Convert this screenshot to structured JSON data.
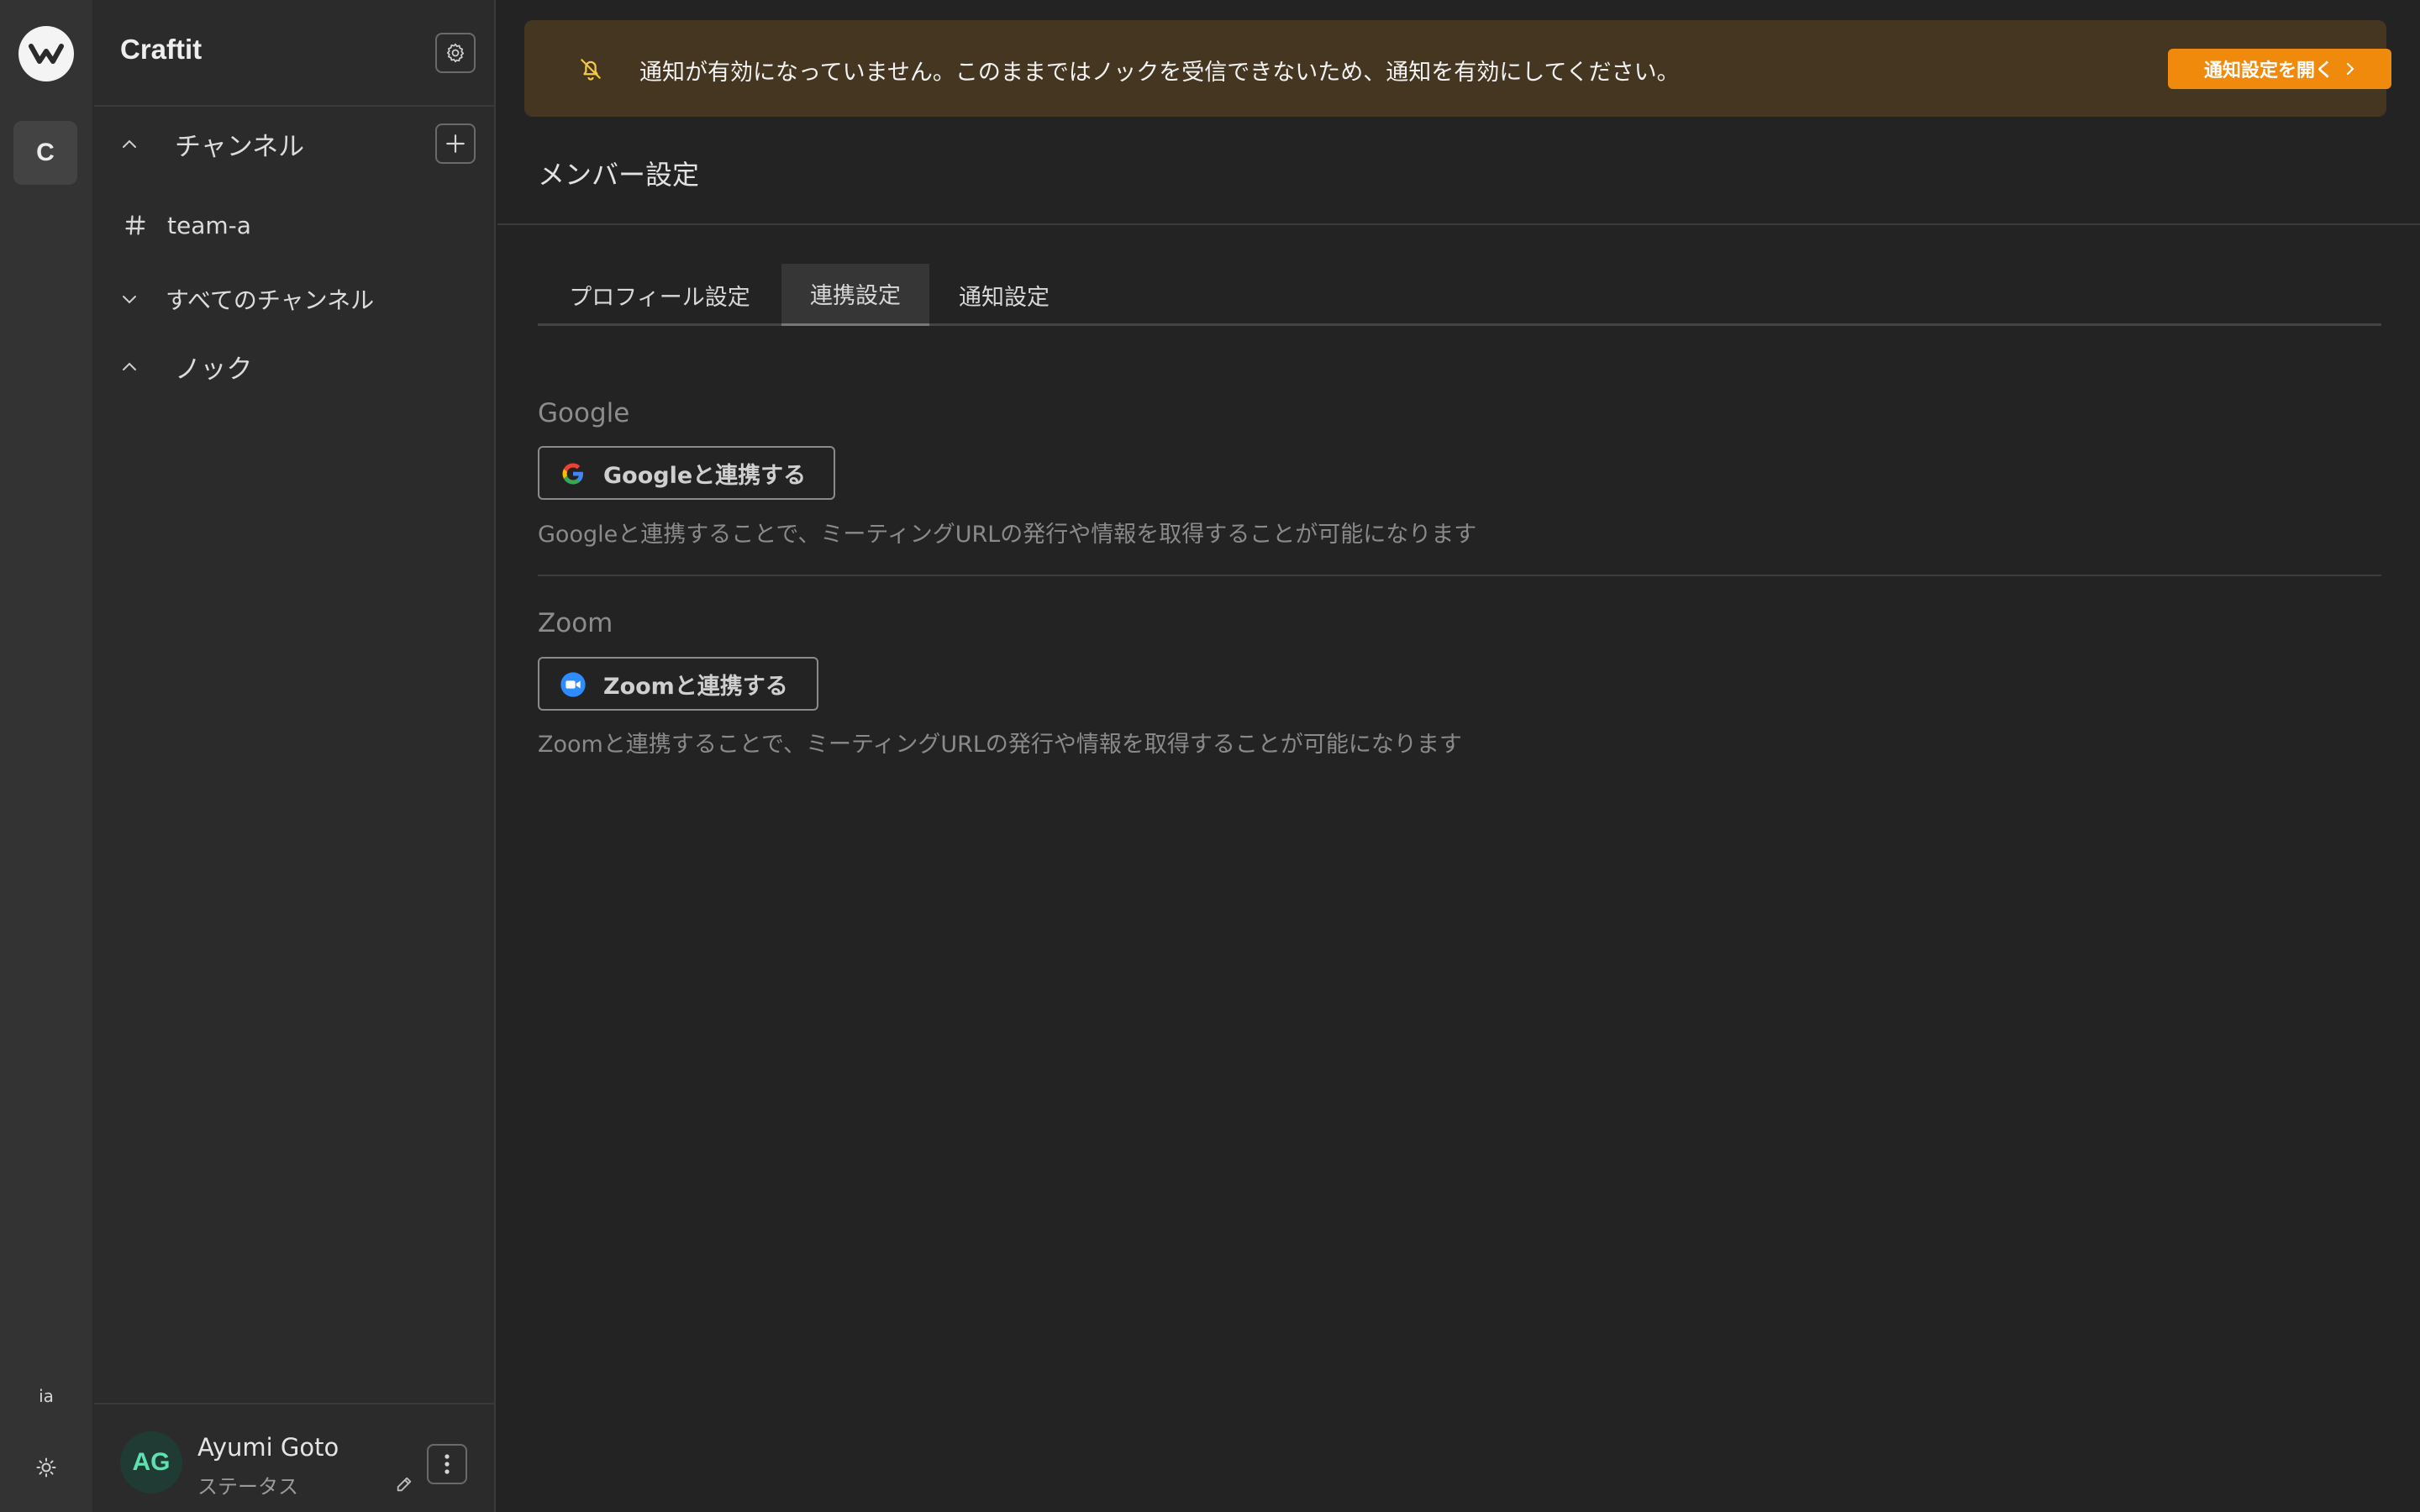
{
  "rail": {
    "workspace_initial": "C",
    "language": "ia"
  },
  "sidebar": {
    "workspace_name": "Craftit",
    "sections": {
      "channels": "チャンネル",
      "all_channels": "すべてのチャンネル",
      "knock": "ノック"
    },
    "channels": [
      {
        "name": "team-a"
      }
    ],
    "user": {
      "initials": "AG",
      "name": "Ayumi Goto",
      "status": "ステータス"
    }
  },
  "banner": {
    "message": "通知が有効になっていません。このままではノックを受信できないため、通知を有効にしてください。",
    "button_label": "通知設定を開く"
  },
  "page": {
    "title": "メンバー設定",
    "tabs": [
      {
        "label": "プロフィール設定",
        "active": false
      },
      {
        "label": "連携設定",
        "active": true
      },
      {
        "label": "通知設定",
        "active": false
      }
    ]
  },
  "integrations": {
    "google": {
      "title": "Google",
      "button_label": "Googleと連携する",
      "description": "Googleと連携することで、ミーティングURLの発行や情報を取得することが可能になります"
    },
    "zoom": {
      "title": "Zoom",
      "button_label": "Zoomと連携する",
      "description": "Zoomと連携することで、ミーティングURLの発行や情報を取得することが可能になります"
    }
  },
  "colors": {
    "banner_bg": "#443621",
    "banner_button": "#f08a0c",
    "zoom_blue": "#2d8cff",
    "avatar_text": "#5fe0b0"
  }
}
